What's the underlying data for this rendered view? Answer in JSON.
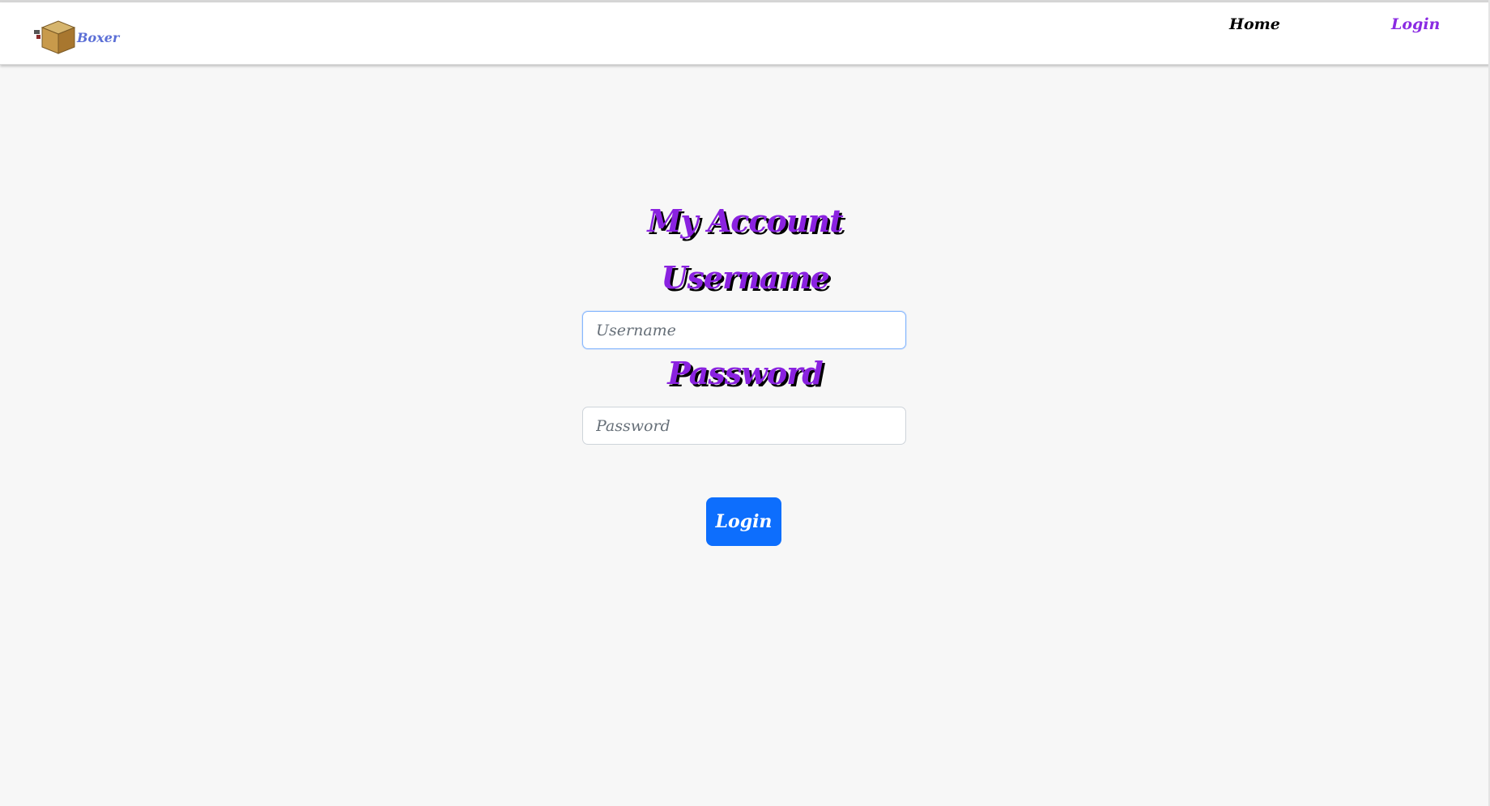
{
  "brand": {
    "name": "Boxer",
    "logo_icon": "cardboard-box-icon"
  },
  "nav": {
    "home_label": "Home",
    "login_label": "Login"
  },
  "main": {
    "title": "My Account",
    "username_label": "Username",
    "username_placeholder": "Username",
    "username_value": "",
    "password_label": "Password",
    "password_placeholder": "Password",
    "password_value": "",
    "submit_label": "Login"
  },
  "colors": {
    "accent_purple": "#8a22e0",
    "button_blue": "#0d6efd",
    "brand_text": "#5b6fd6",
    "page_background": "#f7f7f7"
  }
}
